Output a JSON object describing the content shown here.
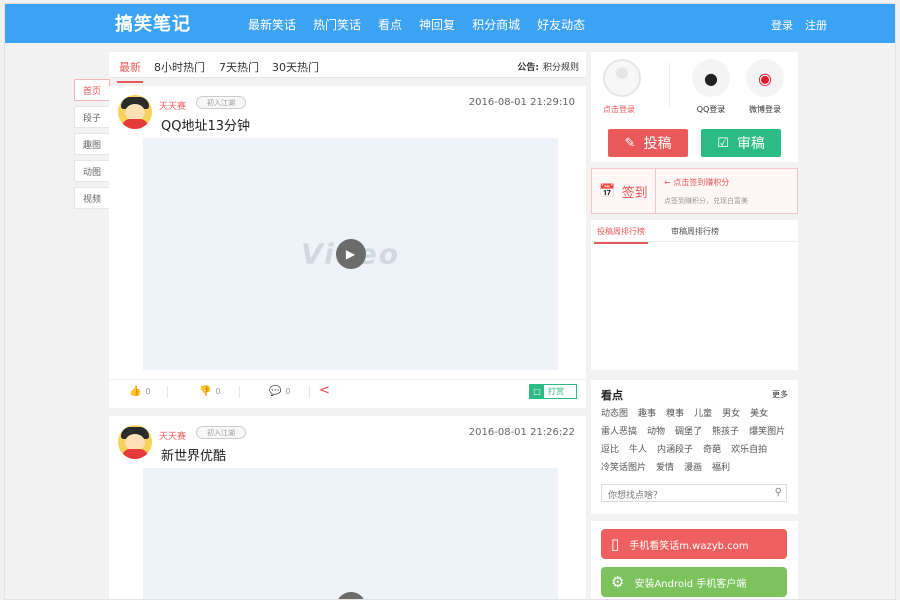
{
  "header": {
    "logo": "搞笑笔记",
    "nav": [
      "最新笑话",
      "热门笑话",
      "看点",
      "神回复",
      "积分商城",
      "好友动态"
    ],
    "login": "登录",
    "register": "注册"
  },
  "sidetabs": [
    "首页",
    "段子",
    "趣图",
    "动图",
    "视频"
  ],
  "main": {
    "tabs": [
      "最新",
      "8小时热门",
      "7天热门",
      "30天热门"
    ],
    "notice_label": "公告:",
    "notice_text": "积分规则",
    "posts": [
      {
        "user": "天天赛",
        "badge": "初入江湖",
        "date": "2016-08-01 21:29:10",
        "title": "QQ地址13分钟",
        "video_label": "Video",
        "likes": "0",
        "dislikes": "0",
        "comments": "0",
        "reward": "打赏"
      },
      {
        "user": "天天赛",
        "badge": "初入江湖",
        "date": "2016-08-01 21:26:22",
        "title": "新世界优酷",
        "video_label": ""
      }
    ]
  },
  "sidebar": {
    "login_text": "点击登录",
    "qq_login": "QQ登录",
    "weibo_login": "微博登录",
    "submit_btn": "投稿",
    "review_btn": "审稿",
    "sign_btn": "签到",
    "sign_line1": "点击签到赚积分",
    "sign_line2": "点签到赚积分，兑现白富美",
    "rank_tabs": [
      "投稿周排行榜",
      "审稿周排行榜"
    ],
    "hot": {
      "title": "看点",
      "more": "更多",
      "tags": [
        "动态图",
        "趣事",
        "糗事",
        "儿童",
        "男女",
        "美女",
        "雷人恶搞",
        "动物",
        "碉堡了",
        "熊孩子",
        "爆笑图片",
        "逗比",
        "牛人",
        "内涵段子",
        "奇葩",
        "欢乐自拍",
        "冷笑话图片",
        "爱情",
        "漫画",
        "福利"
      ],
      "search_placeholder": "你想找点啥？"
    },
    "app_mobile": "手机看笑话m.wazyb.com",
    "app_android": "安装Android 手机客户端"
  },
  "colors": {
    "nav": "#3ca2f3",
    "accent": "#ea5a5a",
    "green": "#2dbb84"
  }
}
